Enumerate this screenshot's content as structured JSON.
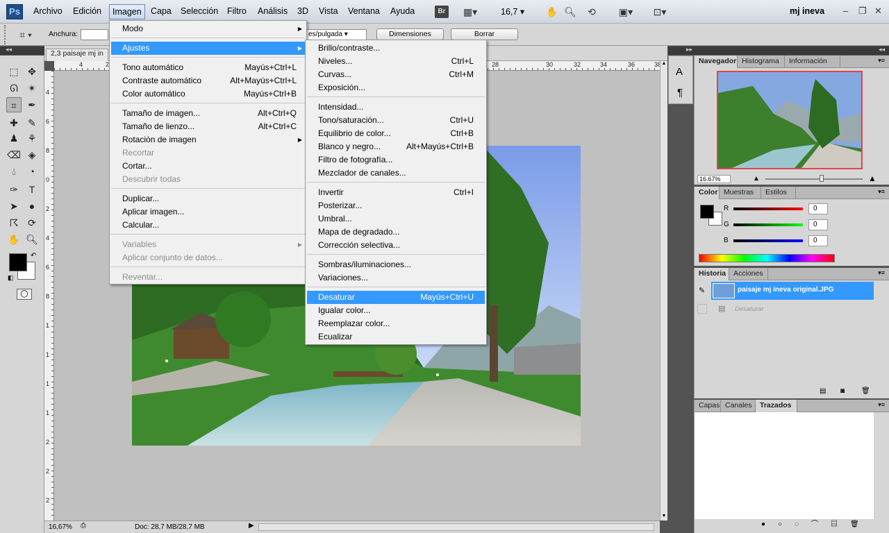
{
  "app": {
    "logo": "Ps",
    "user": "mj ineva",
    "zoom": "16,7",
    "bridge": "Br"
  },
  "menubar": [
    "Archivo",
    "Edición",
    "Imagen",
    "Capa",
    "Selección",
    "Filtro",
    "Análisis",
    "3D",
    "Vista",
    "Ventana",
    "Ayuda"
  ],
  "options": {
    "width_label": "Anchura:",
    "resolution_unit": "es/pulgada",
    "dimensions_btn": "Dimensiones",
    "delete_btn": "Borrar"
  },
  "document": {
    "tab": "2,3 paisaje mj in",
    "zoom": "16,67%",
    "doc_info": "Doc: 28,7 MB/28,7 MB"
  },
  "ruler": {
    "h": [
      "4",
      "2",
      "",
      "",
      "",
      "28",
      "30",
      "32",
      "34",
      "36",
      "38"
    ],
    "v": [
      "4",
      "6",
      "8",
      "0",
      "2",
      "4",
      "6",
      "8",
      "1",
      "1",
      "1",
      "1",
      "2",
      "2",
      "2"
    ]
  },
  "imagen_menu": [
    {
      "label": "Modo",
      "sc": "",
      "sub": true
    },
    {
      "sep": true
    },
    {
      "label": "Ajustes",
      "sc": "",
      "sub": true,
      "hl": true
    },
    {
      "sep": true
    },
    {
      "label": "Tono automático",
      "sc": "Mayús+Ctrl+L"
    },
    {
      "label": "Contraste automático",
      "sc": "Alt+Mayús+Ctrl+L"
    },
    {
      "label": "Color automático",
      "sc": "Mayús+Ctrl+B"
    },
    {
      "sep": true
    },
    {
      "label": "Tamaño de imagen...",
      "sc": "Alt+Ctrl+Q"
    },
    {
      "label": "Tamaño de lienzo...",
      "sc": "Alt+Ctrl+C"
    },
    {
      "label": "Rotación de imagen",
      "sc": "",
      "sub": true
    },
    {
      "label": "Recortar",
      "sc": "",
      "dis": true
    },
    {
      "label": "Cortar...",
      "sc": ""
    },
    {
      "label": "Descubrir todas",
      "sc": "",
      "dis": true
    },
    {
      "sep": true
    },
    {
      "label": "Duplicar...",
      "sc": ""
    },
    {
      "label": "Aplicar imagen...",
      "sc": ""
    },
    {
      "label": "Calcular...",
      "sc": ""
    },
    {
      "sep": true
    },
    {
      "label": "Variables",
      "sc": "",
      "sub": true,
      "dis": true
    },
    {
      "label": "Aplicar conjunto de datos...",
      "sc": "",
      "dis": true
    },
    {
      "sep": true
    },
    {
      "label": "Reventar...",
      "sc": "",
      "dis": true
    }
  ],
  "ajustes_menu": [
    {
      "label": "Brillo/contraste...",
      "sc": ""
    },
    {
      "label": "Niveles...",
      "sc": "Ctrl+L"
    },
    {
      "label": "Curvas...",
      "sc": "Ctrl+M"
    },
    {
      "label": "Exposición...",
      "sc": ""
    },
    {
      "sep": true
    },
    {
      "label": "Intensidad...",
      "sc": ""
    },
    {
      "label": "Tono/saturación...",
      "sc": "Ctrl+U"
    },
    {
      "label": "Equilibrio de color...",
      "sc": "Ctrl+B"
    },
    {
      "label": "Blanco y negro...",
      "sc": "Alt+Mayús+Ctrl+B"
    },
    {
      "label": "Filtro de fotografía...",
      "sc": ""
    },
    {
      "label": "Mezclador de canales...",
      "sc": ""
    },
    {
      "sep": true
    },
    {
      "label": "Invertir",
      "sc": "Ctrl+I"
    },
    {
      "label": "Posterizar...",
      "sc": ""
    },
    {
      "label": "Umbral...",
      "sc": ""
    },
    {
      "label": "Mapa de degradado...",
      "sc": ""
    },
    {
      "label": "Corrección selectiva...",
      "sc": ""
    },
    {
      "sep": true
    },
    {
      "label": "Sombras/iluminaciones...",
      "sc": ""
    },
    {
      "label": "Variaciones...",
      "sc": ""
    },
    {
      "sep": true
    },
    {
      "label": "Desaturar",
      "sc": "Mayús+Ctrl+U",
      "hl": true
    },
    {
      "label": "Igualar color...",
      "sc": ""
    },
    {
      "label": "Reemplazar color...",
      "sc": ""
    },
    {
      "label": "Ecualizar",
      "sc": ""
    }
  ],
  "navigator": {
    "tabs": [
      "Navegador",
      "Histograma",
      "Información"
    ],
    "zoom": "16.67%"
  },
  "color_panel": {
    "tabs": [
      "Color",
      "Muestras",
      "Estilos"
    ],
    "r_label": "R",
    "g_label": "G",
    "b_label": "B",
    "r": "0",
    "g": "0",
    "b": "0"
  },
  "history": {
    "tabs": [
      "Historia",
      "Acciones"
    ],
    "snapshot": "paisaje mj ineva original.JPG",
    "step": "Desaturar"
  },
  "layers": {
    "tabs": [
      "Capas",
      "Canales",
      "Trazados"
    ]
  },
  "colors": {
    "highlight": "#3399ff"
  }
}
